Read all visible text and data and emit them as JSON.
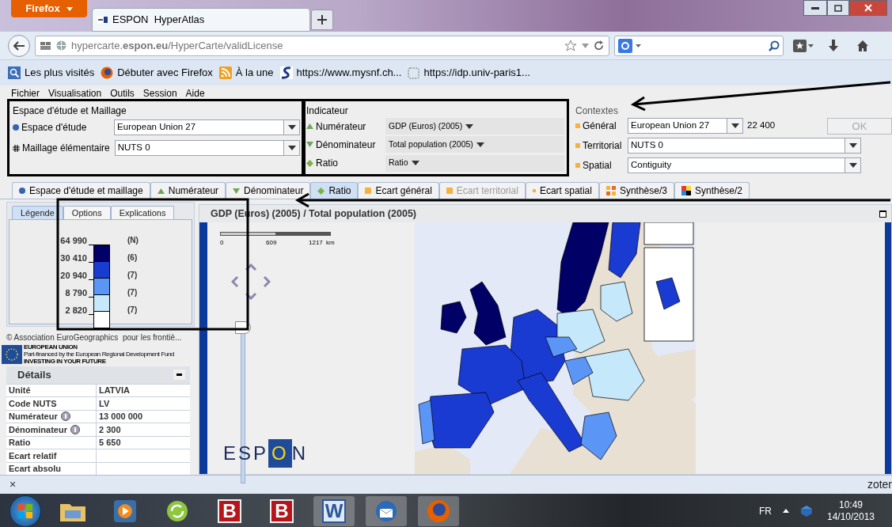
{
  "browser": {
    "menu_button": "Firefox",
    "tab_title": "ESPON  HyperAtlas",
    "url": "hypercarte.**espon.eu**/HyperCarte/validLicense",
    "bookmarks": [
      {
        "kind": "most",
        "label": "Les plus visités"
      },
      {
        "kind": "firefox",
        "label": "Débuter avec Firefox"
      },
      {
        "kind": "rss",
        "label": "À la une"
      },
      {
        "kind": "s",
        "label": "https://www.mysnf.ch..."
      },
      {
        "kind": "blank",
        "label": "https://idp.univ-paris1..."
      }
    ]
  },
  "menu": [
    "Fichier",
    "Visualisation",
    "Outils",
    "Session",
    "Aide"
  ],
  "study_area": {
    "title": "Espace d'étude et Maillage",
    "fields": [
      {
        "kind": "dot",
        "label": "Espace d'étude",
        "value": "European Union 27"
      },
      {
        "kind": "grid",
        "label": "Maillage élémentaire",
        "value": "NUTS 0"
      }
    ]
  },
  "indicator": {
    "title": "Indicateur",
    "fields": [
      {
        "kind": "up",
        "label": "Numérateur",
        "value": "GDP (Euros) (2005)"
      },
      {
        "kind": "down",
        "label": "Dénominateur",
        "value": "Total population (2005)"
      },
      {
        "kind": "diamond",
        "label": "Ratio",
        "value": "Ratio"
      }
    ]
  },
  "context": {
    "title": "Contextes",
    "fields": [
      {
        "label": "Général",
        "value": "European Union 27"
      },
      {
        "label": "Territorial",
        "value": "NUTS 0"
      },
      {
        "label": "Spatial",
        "value": "Contiguity"
      }
    ],
    "general_reading": "22 400",
    "ok_button": {
      "label": "OK",
      "disabled": true
    }
  },
  "tabs": [
    {
      "kind": "dot",
      "label": "Espace d'étude et maillage",
      "selected": false,
      "disabled": false
    },
    {
      "kind": "up",
      "label": "Numérateur",
      "selected": false,
      "disabled": false
    },
    {
      "kind": "down",
      "label": "Dénominateur",
      "selected": false,
      "disabled": false
    },
    {
      "kind": "diamond",
      "label": "Ratio",
      "selected": true,
      "disabled": false
    },
    {
      "kind": "square",
      "label": "Ecart général",
      "selected": false,
      "disabled": false
    },
    {
      "kind": "square",
      "label": "Ecart territorial",
      "selected": false,
      "disabled": true
    },
    {
      "kind": "smalldot",
      "label": "Ecart spatial",
      "selected": false,
      "disabled": false
    },
    {
      "kind": "puzzle",
      "label": "Synthèse/3",
      "selected": false,
      "disabled": false
    },
    {
      "kind": "colors",
      "label": "Synthèse/2",
      "selected": false,
      "disabled": false
    }
  ],
  "side_tabs": [
    {
      "label": "Légende",
      "selected": true
    },
    {
      "label": "Options",
      "selected": false
    },
    {
      "label": "Explications",
      "selected": false
    }
  ],
  "legend": {
    "breaks": [
      "64 990",
      "30 410",
      "20 940",
      "8 790",
      "2 820"
    ],
    "count_header": "(N)",
    "classes": [
      {
        "color": "#000066",
        "count": "(6)"
      },
      {
        "color": "#1a3bd1",
        "count": "(7)"
      },
      {
        "color": "#5b96f7",
        "count": "(7)"
      },
      {
        "color": "#c5e8fb",
        "count": "(7)"
      },
      {
        "color": "#ffffff"
      }
    ]
  },
  "copyright": "© Association EuroGeographics  pour les frontiè...",
  "eu_banner": [
    "EUROPEAN UNION",
    "Part-financed by the European Regional Development Fund",
    "INVESTING IN YOUR FUTURE"
  ],
  "details": {
    "title": "Détails",
    "rows": [
      {
        "label": "Unité",
        "value": "LATVIA",
        "info": false
      },
      {
        "label": "Code NUTS",
        "value": "LV",
        "info": false
      },
      {
        "label": "Numérateur",
        "value": "13 000 000",
        "info": true
      },
      {
        "label": "Dénominateur",
        "value": "2 300",
        "info": true
      },
      {
        "label": "Ratio",
        "value": "5 650",
        "info": false
      },
      {
        "label": "Ecart relatif",
        "info": false
      },
      {
        "label": "Ecart absolu",
        "info": false
      }
    ]
  },
  "map": {
    "title": "GDP (Euros) (2005) / Total population (2005)",
    "scale": [
      "0",
      "609",
      "1217",
      "km"
    ],
    "zoom": {
      "level": 1
    },
    "logo": "ESPON"
  },
  "addon_bar": {
    "close": "×",
    "label": "zoter"
  },
  "taskbar": {
    "apps": [
      {
        "kind": "folder"
      },
      {
        "kind": "media"
      },
      {
        "kind": "sync"
      },
      {
        "kind": "letter",
        "letter": "B"
      },
      {
        "kind": "letter",
        "letter": "B"
      },
      {
        "kind": "word",
        "letter": "W"
      },
      {
        "kind": "mail"
      },
      {
        "kind": "firefox"
      }
    ],
    "language": "FR",
    "time": "10:49",
    "date": "14/10/2013"
  }
}
